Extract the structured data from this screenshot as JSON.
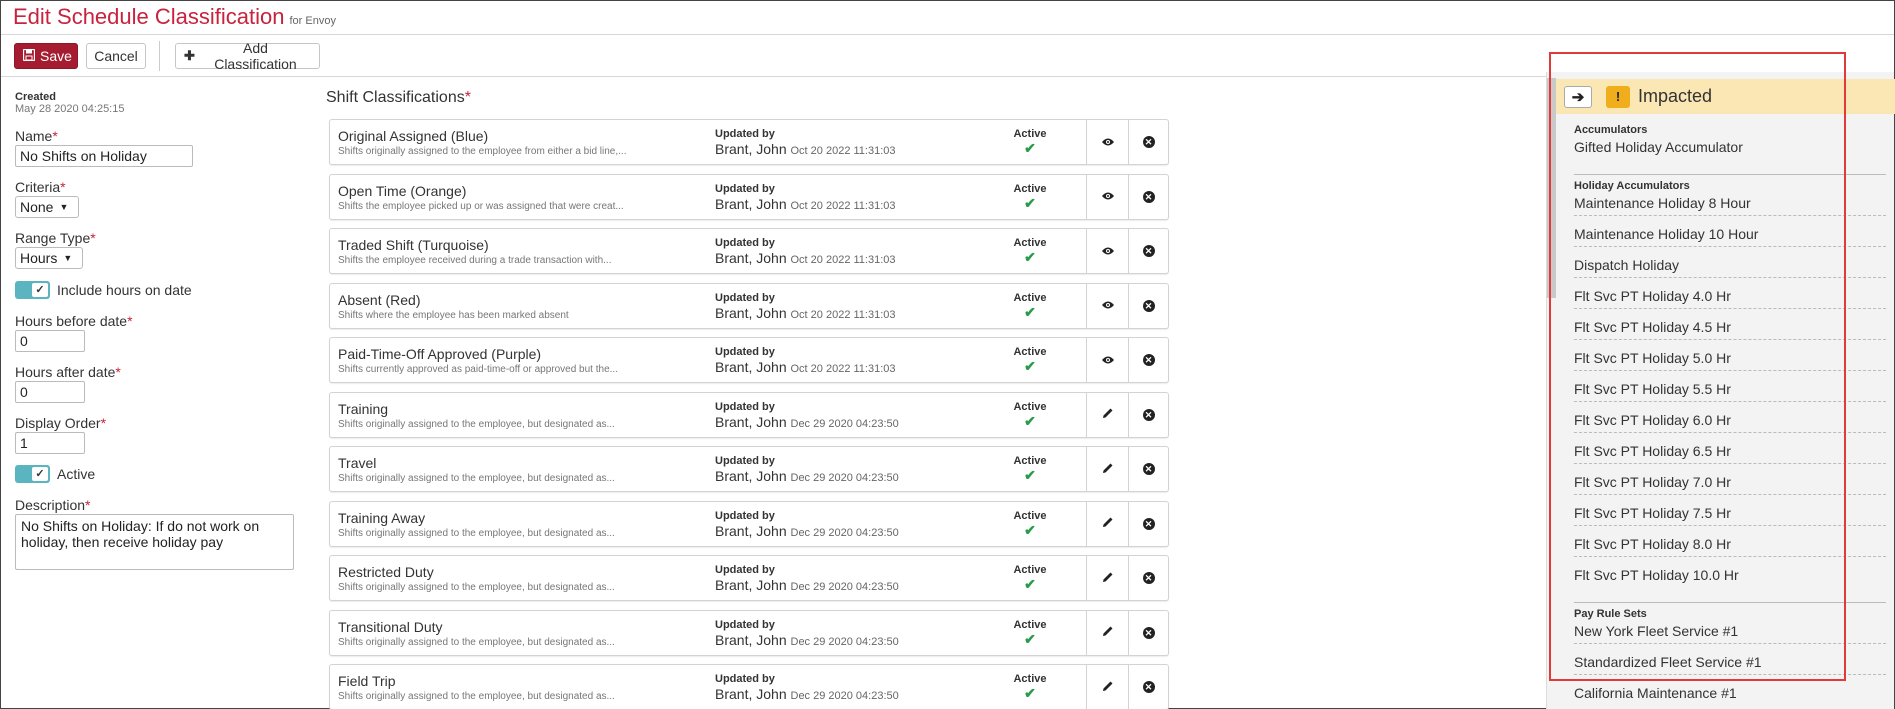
{
  "header": {
    "title": "Edit Schedule Classification",
    "subtitle": "for Envoy"
  },
  "toolbar": {
    "save_label": "Save",
    "cancel_label": "Cancel",
    "add_label": "Add Classification"
  },
  "form": {
    "created_label": "Created",
    "created_value": "May 28 2020 04:25:15",
    "name_label": "Name",
    "name_value": "No Shifts on Holiday",
    "criteria_label": "Criteria",
    "criteria_value": "None",
    "range_type_label": "Range Type",
    "range_type_value": "Hours",
    "include_hours_label": "Include hours on date",
    "hours_before_label": "Hours before date",
    "hours_before_value": "0",
    "hours_after_label": "Hours after date",
    "hours_after_value": "0",
    "display_order_label": "Display Order",
    "display_order_value": "1",
    "active_label": "Active",
    "description_label": "Description",
    "description_value": "No Shifts on Holiday:  If do not work on holiday, then receive holiday pay",
    "required_mark": "*"
  },
  "shift_classifications": {
    "header": "Shift Classifications",
    "updated_by_label": "Updated by",
    "rows": [
      {
        "name": "Original Assigned (Blue)",
        "desc": "Shifts originally assigned to the employee from either a bid line,...",
        "user": "Brant, John",
        "date": "Oct 20 2022 11:31:03",
        "status": "Active",
        "action": "view"
      },
      {
        "name": "Open Time (Orange)",
        "desc": "Shifts the employee picked up or was assigned that were creat...",
        "user": "Brant, John",
        "date": "Oct 20 2022 11:31:03",
        "status": "Active",
        "action": "view"
      },
      {
        "name": "Traded Shift (Turquoise)",
        "desc": "Shifts the employee received during a trade transaction with...",
        "user": "Brant, John",
        "date": "Oct 20 2022 11:31:03",
        "status": "Active",
        "action": "view"
      },
      {
        "name": "Absent (Red)",
        "desc": "Shifts where the employee has been marked absent",
        "user": "Brant, John",
        "date": "Oct 20 2022 11:31:03",
        "status": "Active",
        "action": "view"
      },
      {
        "name": "Paid-Time-Off Approved (Purple)",
        "desc": "Shifts currently approved as paid-time-off or approved but the...",
        "user": "Brant, John",
        "date": "Oct 20 2022 11:31:03",
        "status": "Active",
        "action": "view"
      },
      {
        "name": "Training",
        "desc": "Shifts originally assigned to the employee, but designated as...",
        "user": "Brant, John",
        "date": "Dec 29 2020 04:23:50",
        "status": "Active",
        "action": "edit"
      },
      {
        "name": "Travel",
        "desc": "Shifts originally assigned to the employee, but designated as...",
        "user": "Brant, John",
        "date": "Dec 29 2020 04:23:50",
        "status": "Active",
        "action": "edit"
      },
      {
        "name": "Training Away",
        "desc": "Shifts originally assigned to the employee, but designated as...",
        "user": "Brant, John",
        "date": "Dec 29 2020 04:23:50",
        "status": "Active",
        "action": "edit"
      },
      {
        "name": "Restricted Duty",
        "desc": "Shifts originally assigned to the employee, but designated as...",
        "user": "Brant, John",
        "date": "Dec 29 2020 04:23:50",
        "status": "Active",
        "action": "edit"
      },
      {
        "name": "Transitional Duty",
        "desc": "Shifts originally assigned to the employee, but designated as...",
        "user": "Brant, John",
        "date": "Dec 29 2020 04:23:50",
        "status": "Active",
        "action": "edit"
      },
      {
        "name": "Field Trip",
        "desc": "Shifts originally assigned to the employee, but designated as...",
        "user": "Brant, John",
        "date": "Dec 29 2020 04:23:50",
        "status": "Active",
        "action": "edit"
      }
    ]
  },
  "impacted": {
    "title": "Impacted",
    "sections": [
      {
        "label": "Accumulators",
        "items": [
          "Gifted Holiday Accumulator"
        ]
      },
      {
        "label": "Holiday Accumulators",
        "items": [
          "Maintenance Holiday 8 Hour",
          "Maintenance Holiday 10 Hour",
          "Dispatch Holiday",
          "Flt Svc PT Holiday 4.0 Hr",
          "Flt Svc PT Holiday 4.5 Hr",
          "Flt Svc PT Holiday 5.0 Hr",
          "Flt Svc PT Holiday 5.5 Hr",
          "Flt Svc PT Holiday 6.0 Hr",
          "Flt Svc PT Holiday 6.5 Hr",
          "Flt Svc PT Holiday 7.0 Hr",
          "Flt Svc PT Holiday 7.5 Hr",
          "Flt Svc PT Holiday 8.0 Hr",
          "Flt Svc PT Holiday 10.0 Hr"
        ]
      },
      {
        "label": "Pay Rule Sets",
        "items": [
          "New York Fleet Service #1",
          "Standardized Fleet Service #1",
          "California Maintenance #1"
        ]
      }
    ]
  },
  "colors": {
    "title_red": "#c9223d",
    "save_bg": "#a51c30",
    "toggle_teal": "#5bb5c0",
    "check_green": "#2a9a4b",
    "impacted_bg": "#fbe7b4",
    "warn_orange": "#f0ad1c",
    "highlight_red": "#e03a3a"
  },
  "icons": {
    "save": "floppy-disk-icon",
    "add": "plus-icon",
    "view": "eye-icon",
    "edit": "pencil-icon",
    "remove": "circle-x-icon",
    "check": "check-icon",
    "arrow": "arrow-right-icon",
    "warning": "warning-icon"
  }
}
